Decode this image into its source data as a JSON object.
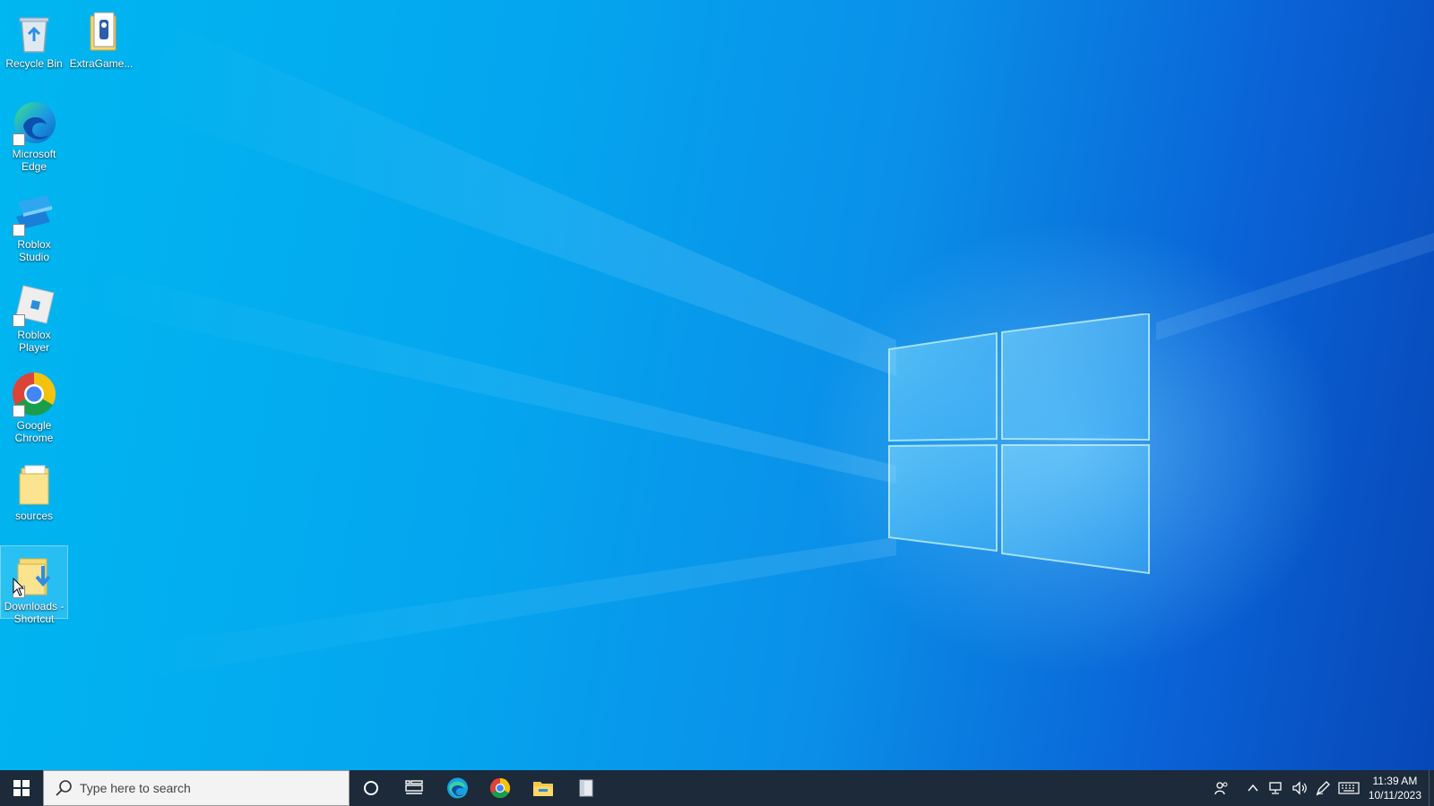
{
  "desktop": {
    "icons": [
      {
        "label": "Recycle Bin",
        "icon": "recycle-bin-icon"
      },
      {
        "label": "ExtraGame...",
        "icon": "folder-document-icon"
      },
      {
        "label": "Microsoft Edge",
        "icon": "edge-icon"
      },
      {
        "label": "Roblox Studio",
        "icon": "roblox-studio-icon"
      },
      {
        "label": "Roblox Player",
        "icon": "roblox-player-icon"
      },
      {
        "label": "Google Chrome",
        "icon": "chrome-icon"
      },
      {
        "label": "sources",
        "icon": "folder-icon"
      },
      {
        "label": "Downloads - Shortcut",
        "icon": "downloads-folder-icon"
      }
    ]
  },
  "taskbar": {
    "search": {
      "placeholder": "Type here to search"
    },
    "pinned": [
      "edge-icon",
      "chrome-icon",
      "file-explorer-icon",
      "notepad-icon"
    ],
    "tray": {
      "icons": [
        "people-icon",
        "chevron-up-icon",
        "network-icon",
        "volume-icon",
        "pen-icon",
        "keyboard-icon"
      ],
      "time": "11:39 AM",
      "date": "10/11/2023"
    }
  },
  "colors": {
    "wallpaper_left": "#00b7f0",
    "wallpaper_right": "#0747b8",
    "taskbar": "#1c2a3a"
  }
}
